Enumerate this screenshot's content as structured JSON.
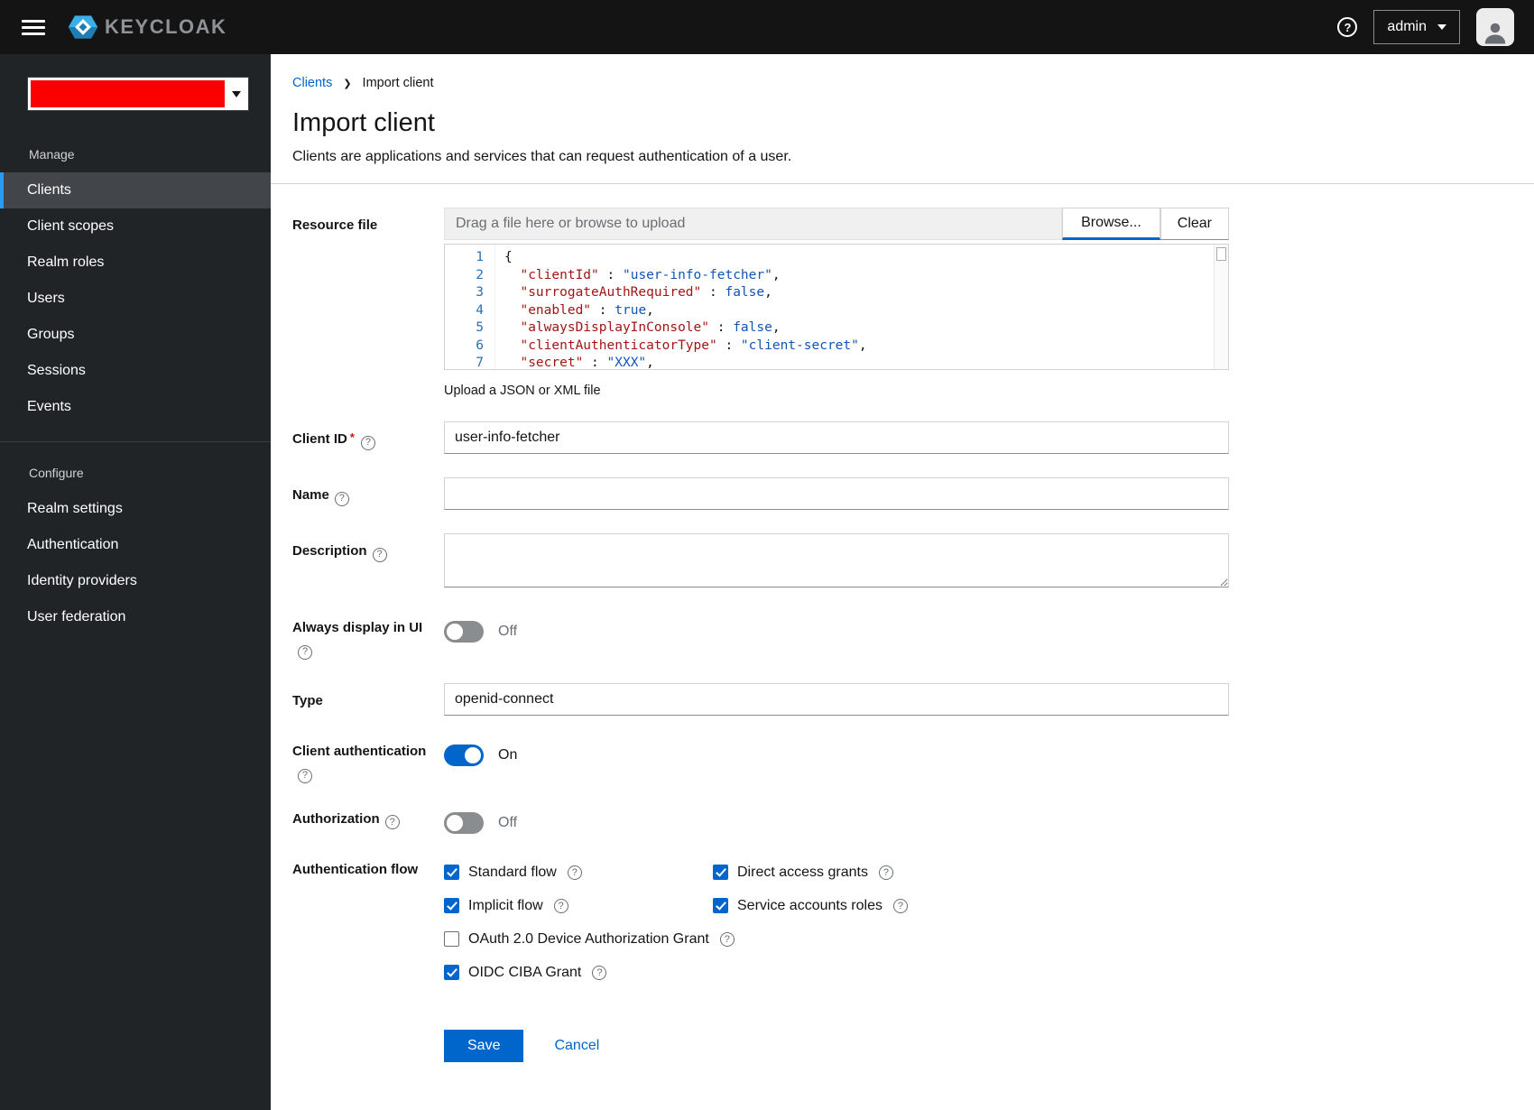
{
  "topbar": {
    "brand": "KEYCLOAK",
    "user": "admin"
  },
  "sidebar": {
    "manage_label": "Manage",
    "manage_items": [
      "Clients",
      "Client scopes",
      "Realm roles",
      "Users",
      "Groups",
      "Sessions",
      "Events"
    ],
    "configure_label": "Configure",
    "configure_items": [
      "Realm settings",
      "Authentication",
      "Identity providers",
      "User federation"
    ],
    "selected_item": "Clients"
  },
  "breadcrumb": {
    "parent": "Clients",
    "current": "Import client"
  },
  "page": {
    "title": "Import client",
    "subtitle": "Clients are applications and services that can request authentication of a user."
  },
  "form": {
    "resource_file": {
      "label": "Resource file",
      "placeholder": "Drag a file here or browse to upload",
      "browse": "Browse...",
      "clear": "Clear",
      "helper": "Upload a JSON or XML file",
      "code": [
        {
          "n": "1",
          "tokens": [
            [
              "p",
              "{"
            ]
          ]
        },
        {
          "n": "2",
          "tokens": [
            [
              "p",
              "  "
            ],
            [
              "k",
              "\"clientId\""
            ],
            [
              "p",
              " : "
            ],
            [
              "s",
              "\"user-info-fetcher\""
            ],
            [
              "p",
              ","
            ]
          ]
        },
        {
          "n": "3",
          "tokens": [
            [
              "p",
              "  "
            ],
            [
              "k",
              "\"surrogateAuthRequired\""
            ],
            [
              "p",
              " : "
            ],
            [
              "b",
              "false"
            ],
            [
              "p",
              ","
            ]
          ]
        },
        {
          "n": "4",
          "tokens": [
            [
              "p",
              "  "
            ],
            [
              "k",
              "\"enabled\""
            ],
            [
              "p",
              " : "
            ],
            [
              "b",
              "true"
            ],
            [
              "p",
              ","
            ]
          ]
        },
        {
          "n": "5",
          "tokens": [
            [
              "p",
              "  "
            ],
            [
              "k",
              "\"alwaysDisplayInConsole\""
            ],
            [
              "p",
              " : "
            ],
            [
              "b",
              "false"
            ],
            [
              "p",
              ","
            ]
          ]
        },
        {
          "n": "6",
          "tokens": [
            [
              "p",
              "  "
            ],
            [
              "k",
              "\"clientAuthenticatorType\""
            ],
            [
              "p",
              " : "
            ],
            [
              "s",
              "\"client-secret\""
            ],
            [
              "p",
              ","
            ]
          ]
        },
        {
          "n": "7",
          "tokens": [
            [
              "p",
              "  "
            ],
            [
              "k",
              "\"secret\""
            ],
            [
              "p",
              " : "
            ],
            [
              "s",
              "\"XXX\""
            ],
            [
              "p",
              ","
            ]
          ]
        }
      ]
    },
    "client_id": {
      "label": "Client ID",
      "value": "user-info-fetcher"
    },
    "name": {
      "label": "Name",
      "value": ""
    },
    "description": {
      "label": "Description",
      "value": ""
    },
    "always_display": {
      "label": "Always display in UI",
      "state": false,
      "state_label": "Off"
    },
    "type": {
      "label": "Type",
      "value": "openid-connect"
    },
    "client_auth": {
      "label": "Client authentication",
      "state": true,
      "state_label": "On"
    },
    "authorization": {
      "label": "Authorization",
      "state": false,
      "state_label": "Off"
    },
    "auth_flow": {
      "label": "Authentication flow",
      "options": [
        {
          "label": "Standard flow",
          "checked": true
        },
        {
          "label": "Direct access grants",
          "checked": true
        },
        {
          "label": "Implicit flow",
          "checked": true
        },
        {
          "label": "Service accounts roles",
          "checked": true
        },
        {
          "label": "OAuth 2.0 Device Authorization Grant",
          "checked": false
        },
        {
          "label": "OIDC CIBA Grant",
          "checked": true
        }
      ]
    },
    "actions": {
      "save": "Save",
      "cancel": "Cancel"
    }
  }
}
